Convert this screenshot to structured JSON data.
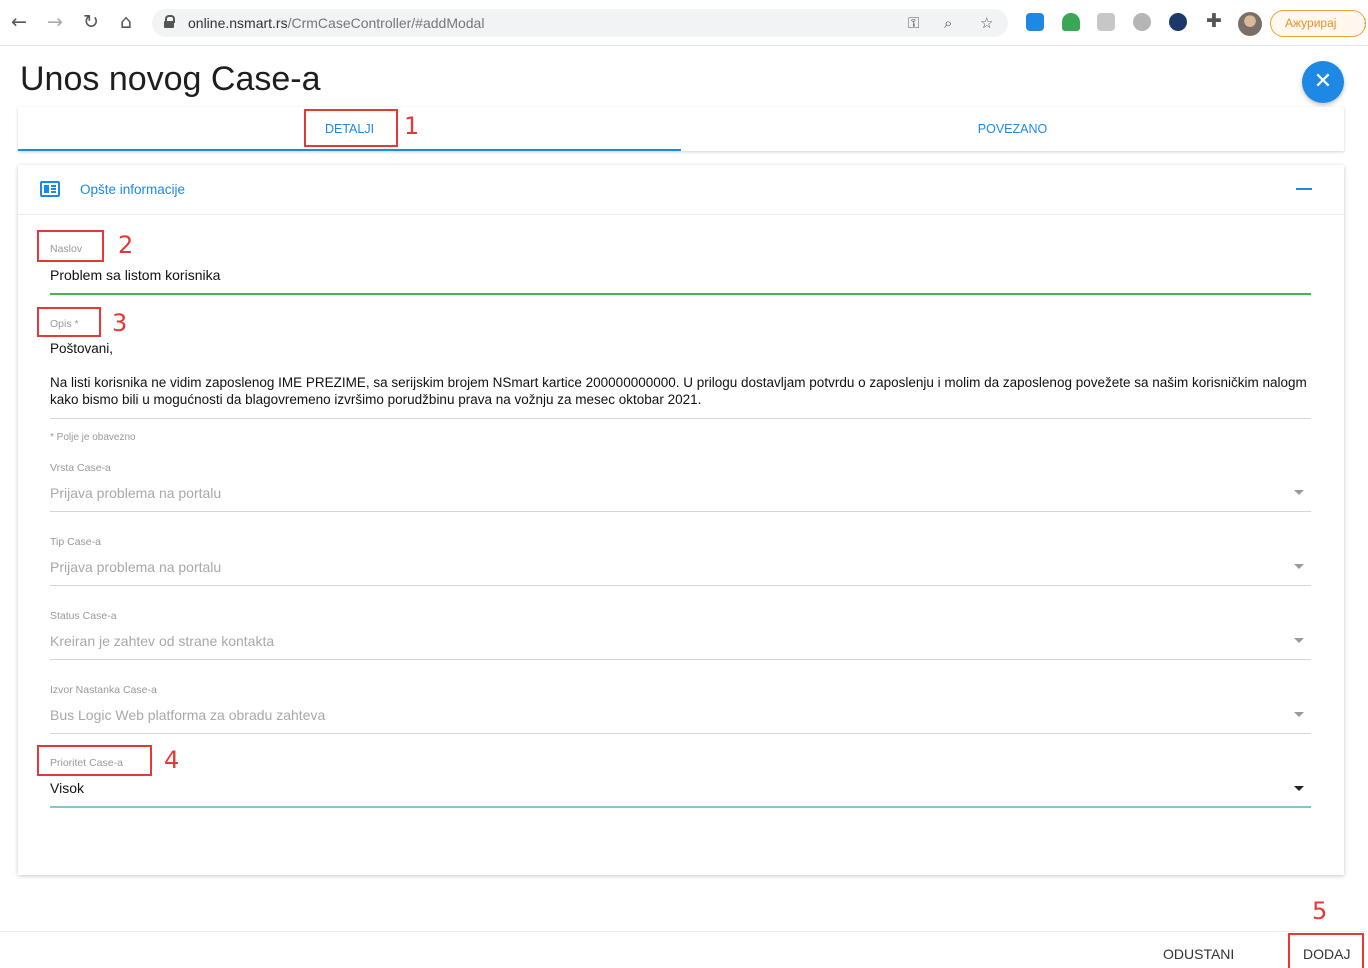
{
  "browser": {
    "back_icon": "arrow-left-icon",
    "url_host": "online.nsmart.rs",
    "url_path": "/CrmCaseController/#addModal",
    "update_label": "Ажурирај"
  },
  "modal": {
    "title": "Unos novog Case-a",
    "tabs": [
      {
        "label": "DETALJI",
        "active": true
      },
      {
        "label": "POVEZANO",
        "active": false
      }
    ],
    "section_title": "Opšte informacije",
    "fields": {
      "naslov": {
        "label": "Naslov",
        "value": "Problem sa listom korisnika"
      },
      "opis": {
        "label": "Opis *",
        "greeting": "Poštovani,",
        "body": "Na listi korisnika ne vidim zaposlenog IME PREZIME, sa serijskim brojem NSmart kartice 200000000000. U prilogu dostavljam potvrdu o zaposlenju i molim da zaposlenog povežete sa našim korisničkim nalogm kako bismo bili u mogućnosti da blagovremeno izvršimo porudžbinu prava na vožnju za mesec oktobar 2021."
      },
      "required_note": "* Polje je obavezno",
      "vrsta": {
        "label": "Vrsta Case-a",
        "value": "Prijava problema na portalu"
      },
      "tip": {
        "label": "Tip Case-a",
        "value": "Prijava problema na portalu"
      },
      "status": {
        "label": "Status Case-a",
        "value": "Kreiran je zahtev od strane kontakta"
      },
      "izvor": {
        "label": "Izvor Nastanka Case-a",
        "value": "Bus Logic Web platforma za obradu zahteva"
      },
      "prioritet": {
        "label": "Prioritet Case-a",
        "value": "Visok"
      }
    },
    "footer": {
      "cancel_label": "ODUSTANI",
      "add_label": "DODAJ"
    }
  },
  "annotations": [
    "1",
    "2",
    "3",
    "4",
    "5"
  ],
  "colors": {
    "accent": "#1e88e5",
    "annotation": "#e53935",
    "valid": "#4caf50"
  }
}
